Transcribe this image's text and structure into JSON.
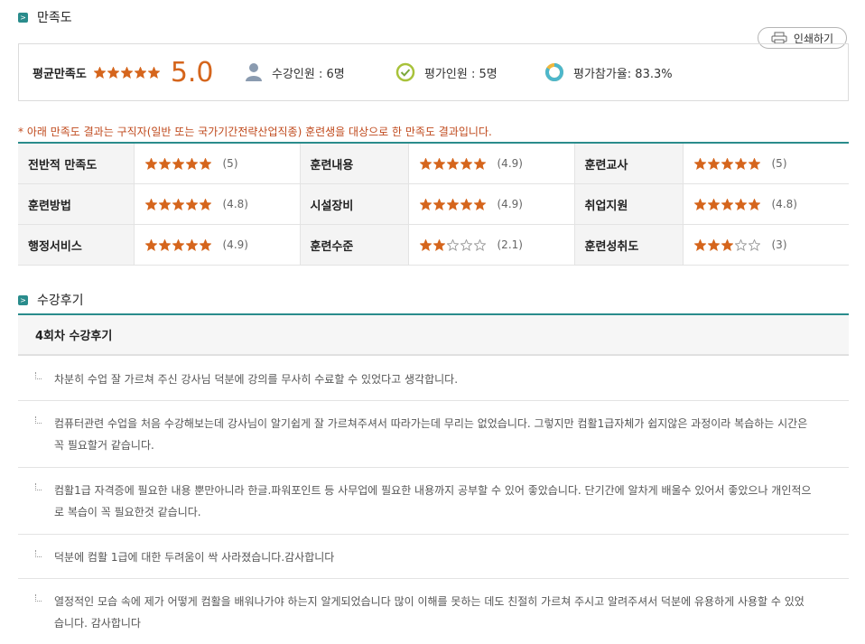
{
  "section1": {
    "title": "만족도",
    "bullet": ">"
  },
  "print_button": {
    "label": "인쇄하기",
    "icon": "printer-icon"
  },
  "summary": {
    "avg_label": "평균만족도",
    "avg_stars": 5,
    "avg_score": "5.0",
    "enrolled": "수강인원 : 6명",
    "evaluators": "평가인원 : 5명",
    "participation": "평가참가율: 83.3%",
    "participation_fraction": 0.833,
    "colors": {
      "accent": "#d5651c",
      "teal": "#2a8c8c",
      "check": "#a8c23a",
      "ring": "#4db7cc"
    }
  },
  "notice": "* 아래 만족도 결과는 구직자(일반 또는 국가기간전략산업직종) 훈련생을 대상으로 한 만족도 결과입니다.",
  "ratings": [
    {
      "label": "전반적 만족도",
      "stars": 5,
      "score": "(5)"
    },
    {
      "label": "훈련내용",
      "stars": 5,
      "score": "(4.9)"
    },
    {
      "label": "훈련교사",
      "stars": 5,
      "score": "(5)"
    },
    {
      "label": "훈련방법",
      "stars": 5,
      "score": "(4.8)"
    },
    {
      "label": "시설장비",
      "stars": 5,
      "score": "(4.9)"
    },
    {
      "label": "취업지원",
      "stars": 5,
      "score": "(4.8)"
    },
    {
      "label": "행정서비스",
      "stars": 5,
      "score": "(4.9)"
    },
    {
      "label": "훈련수준",
      "stars": 2,
      "score": "(2.1)"
    },
    {
      "label": "훈련성취도",
      "stars": 3,
      "score": "(3)"
    }
  ],
  "section2": {
    "title": "수강후기",
    "bullet": ">"
  },
  "review_header": "4회차 수강후기",
  "reviews": [
    "차분히 수업 잘 가르쳐 주신 강사님 덕분에 강의를 무사히 수료할 수 있었다고 생각합니다.",
    "컴퓨터관련 수업을 처음 수강해보는데 강사님이 알기쉽게 잘 가르쳐주셔서 따라가는데 무리는 없었습니다. 그렇지만 컴활1급자체가 쉽지않은 과정이라 복습하는 시간은 꼭 필요할거 같습니다.",
    "컴활1급 자격증에 필요한 내용 뿐만아니라 한글.파워포인트 등 사무업에 필요한 내용까지 공부할 수 있어 좋았습니다. 단기간에 알차게 배울수 있어서 좋았으나 개인적으로 복습이 꼭 필요한것 같습니다.",
    "덕분에 컴활 1급에 대한 두려움이 싹 사라졌습니다.감사합니다",
    "열정적인 모습 속에 제가 어떻게 컴활을 배워나가야 하는지 알게되었습니다 많이 이해를 못하는 데도 친절히 가르쳐 주시고 알려주셔서 덕분에 유용하게 사용할 수 있었습니다. 감사합니다"
  ]
}
